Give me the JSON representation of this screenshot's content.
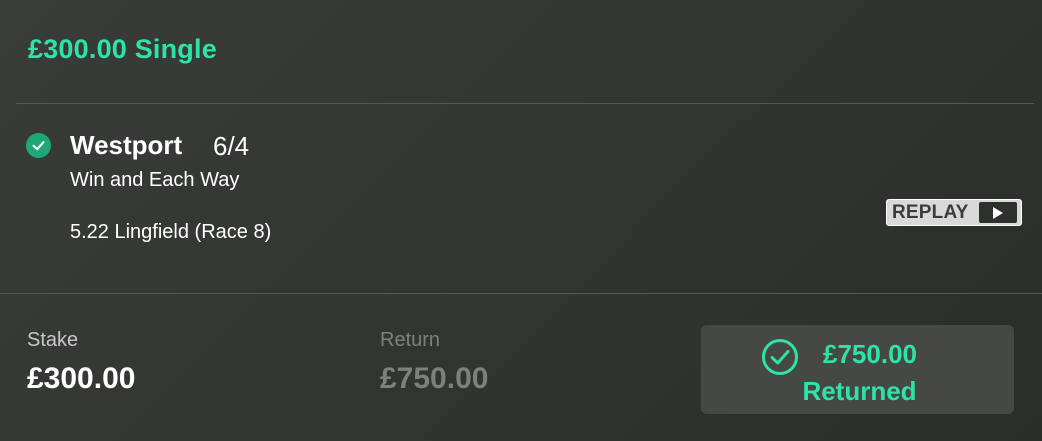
{
  "bet": {
    "title": "£300.00 Single"
  },
  "selection": {
    "status_icon": "check-circle-icon",
    "name": "Westport",
    "odds": "6/4",
    "market": "Win and Each Way",
    "event": "5.22 Lingfield (Race 8)",
    "replay_label": "REPLAY",
    "replay_icon": "play-icon"
  },
  "summary": {
    "stake_label": "Stake",
    "stake_value": "£300.00",
    "return_label": "Return",
    "return_value": "£750.00",
    "returned_amount": "£750.00",
    "returned_text": "Returned",
    "returned_icon": "check-circle-outline-icon"
  },
  "colors": {
    "accent": "#2ee3a6",
    "win_badge": "#1fa876",
    "background": "#353735",
    "muted_text": "#7e807e"
  }
}
